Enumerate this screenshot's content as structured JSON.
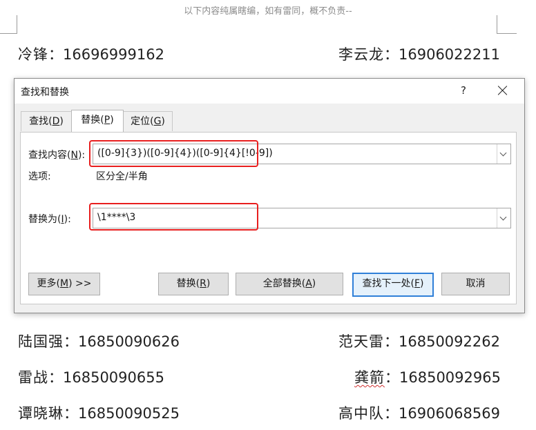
{
  "doc": {
    "header": "以下内容纯属瞎编，如有雷同，概不负责--",
    "entries": [
      {
        "name": "冷锋",
        "number": "16696999162"
      },
      {
        "name": "李云龙",
        "number": "16906022211"
      },
      {
        "name": "陆国强",
        "number": "16850090626"
      },
      {
        "name": "范天雷",
        "number": "16850092262"
      },
      {
        "name": "雷战",
        "number": "16850090655"
      },
      {
        "name": "龚箭",
        "number": "16850092965"
      },
      {
        "name": "谭晓琳",
        "number": "16850090525"
      },
      {
        "name": "高中队",
        "number": "16906068569"
      }
    ],
    "separator": "："
  },
  "dialog": {
    "title": "查找和替换",
    "help": "?",
    "tabs": [
      {
        "label": "查找",
        "key": "D"
      },
      {
        "label": "替换",
        "key": "P"
      },
      {
        "label": "定位",
        "key": "G"
      }
    ],
    "find": {
      "label": "查找内容",
      "key": "N",
      "value": "([0-9]{3})([0-9]{4})([0-9]{4}[!0-9])"
    },
    "options": {
      "label": "选项:",
      "value": "区分全/半角"
    },
    "replace": {
      "label": "替换为",
      "key": "I",
      "value": "\\1****\\3"
    },
    "buttons": {
      "more": {
        "label": "更多",
        "key": "M",
        "suffix": " >>"
      },
      "replace": {
        "label": "替换",
        "key": "R"
      },
      "replace_all": {
        "label": "全部替换",
        "key": "A"
      },
      "find_next": {
        "label": "查找下一处",
        "key": "F"
      },
      "cancel": {
        "label": "取消"
      }
    }
  },
  "colors": {
    "highlight": "#e81e1e",
    "default_button_border": "#2f7fd8"
  }
}
